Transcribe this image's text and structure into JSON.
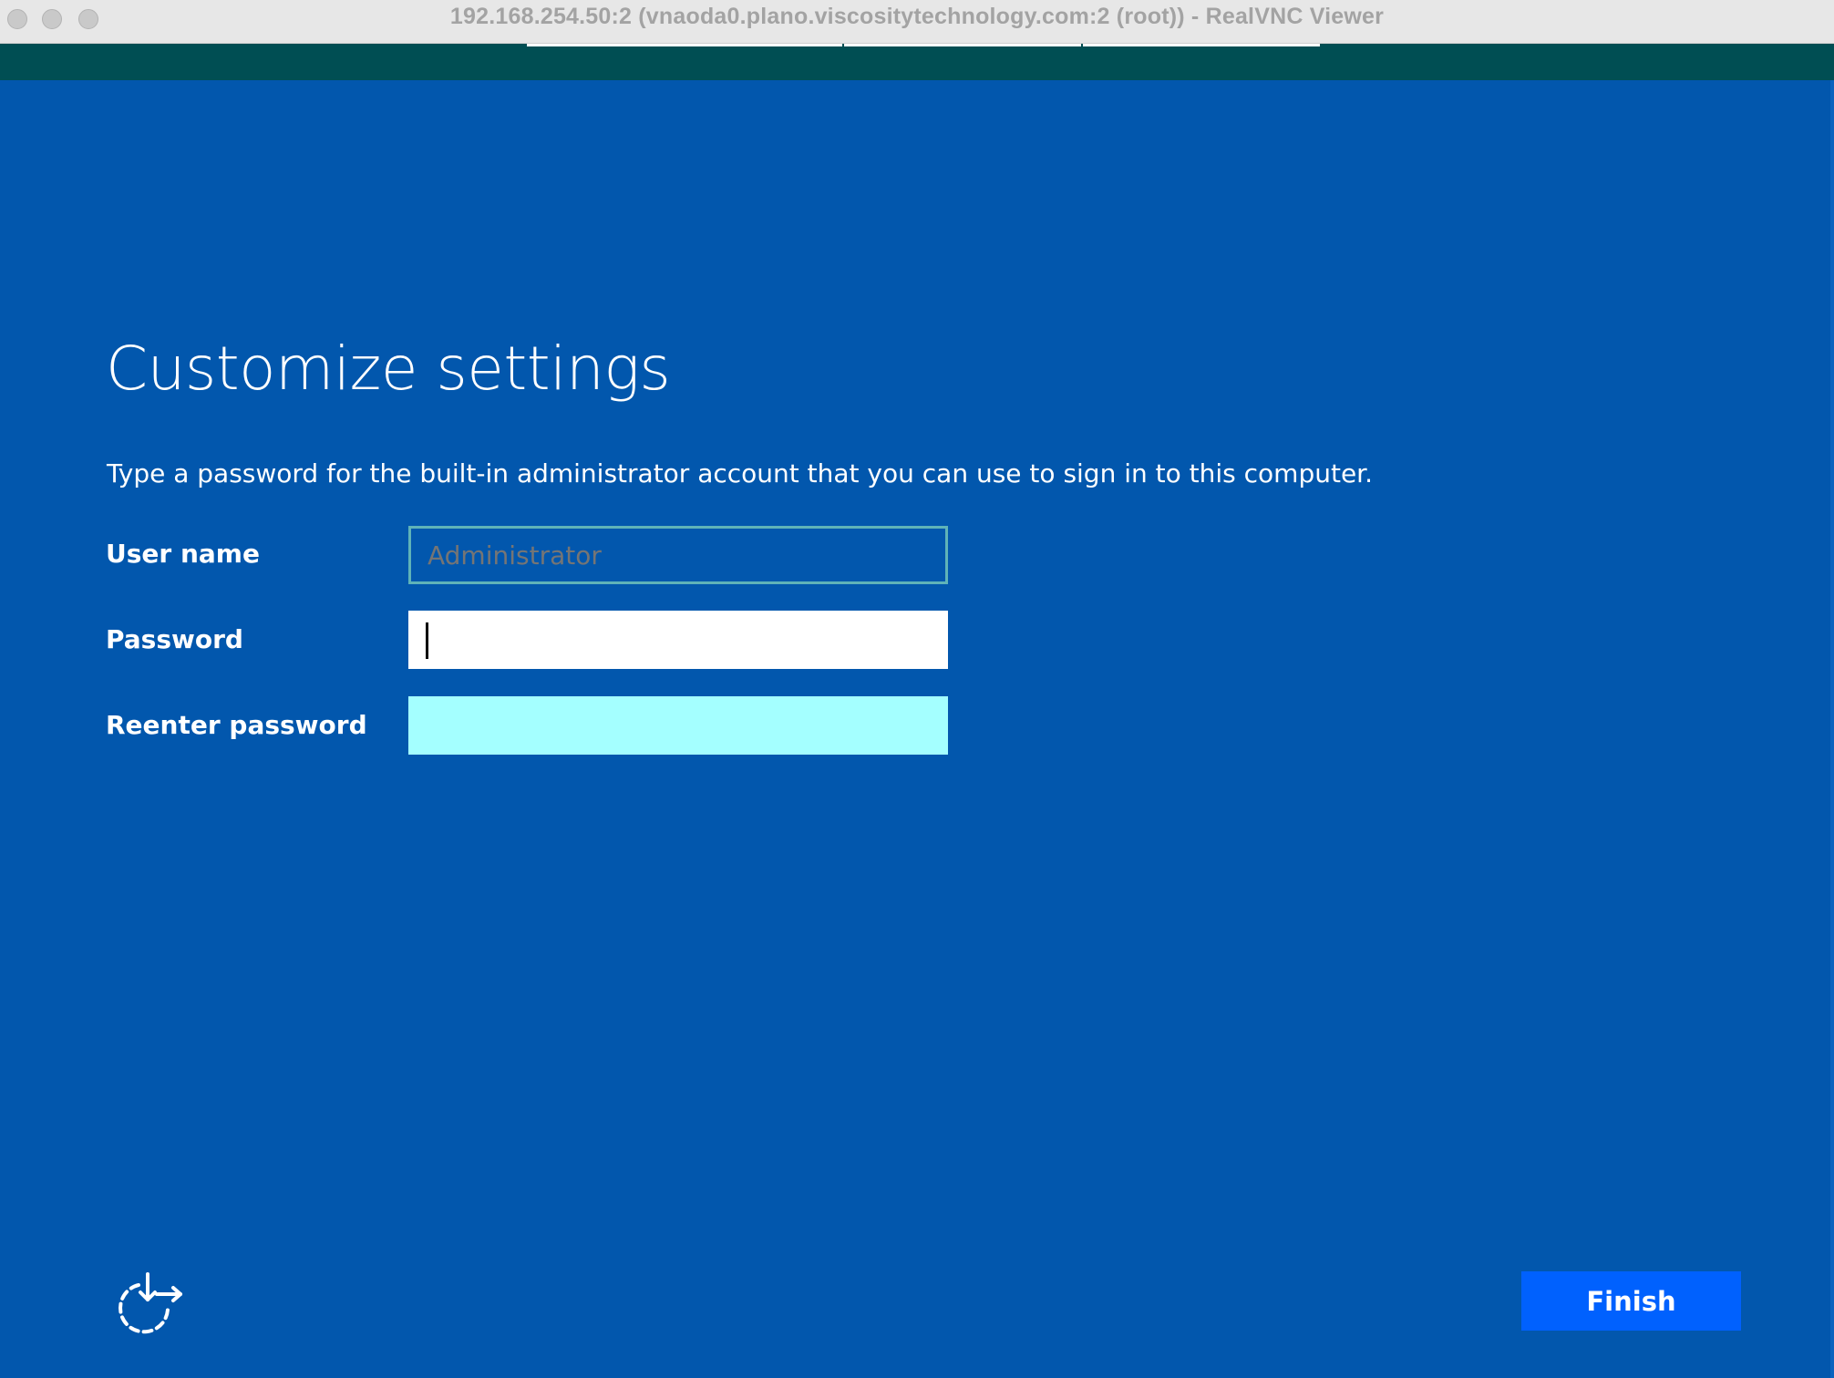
{
  "window": {
    "title": "192.168.254.50:2 (vnaoda0.plano.viscositytechnology.com:2 (root)) - RealVNC Viewer"
  },
  "setup": {
    "heading": "Customize settings",
    "instructions": "Type a password for the built-in administrator account that you can use to sign in to this computer.",
    "fields": {
      "username": {
        "label": "User name",
        "placeholder": "Administrator",
        "value": ""
      },
      "password": {
        "label": "Password",
        "value": ""
      },
      "reenter_password": {
        "label": "Reenter password",
        "value": ""
      }
    },
    "finish_label": "Finish",
    "accessibility_icon": "ease-of-access-icon"
  },
  "colors": {
    "background": "#0257ad",
    "vnc_strip": "#004e53",
    "finish_button": "#0061fe",
    "reenter_field": "#a4ffff",
    "username_border": "#5fb3b8"
  }
}
